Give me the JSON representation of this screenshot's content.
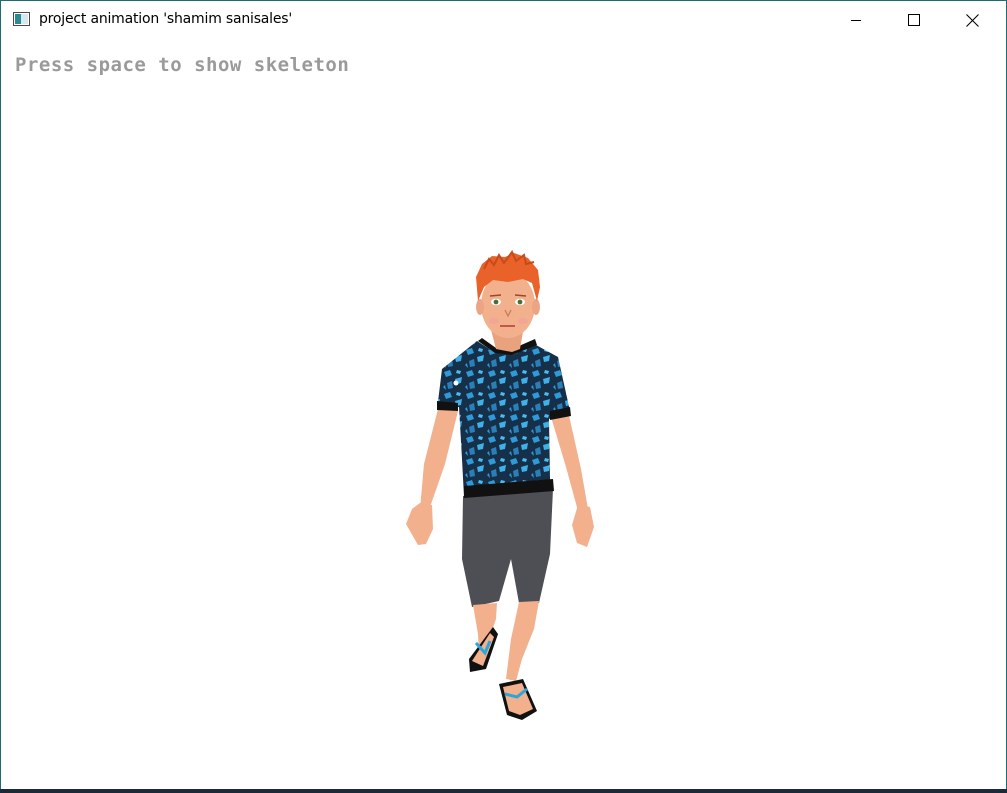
{
  "window": {
    "title": "project animation 'shamim sanisales'",
    "accent_border": "#1e6b73"
  },
  "controls": {
    "minimize": "minimize-icon",
    "maximize": "maximize-icon",
    "close": "close-icon"
  },
  "viewport": {
    "hint_text": "Press space to show skeleton",
    "hint_color": "#9a9a9a",
    "background": "#ffffff"
  },
  "character": {
    "hair_color": "#e8622a",
    "skin_color": "#f2b08c",
    "shirt_color": "#1a3552",
    "shirt_pattern_color": "#2f9ad8",
    "shorts_color": "#4e4e55",
    "sandal_strap_color": "#2aa7d9"
  }
}
